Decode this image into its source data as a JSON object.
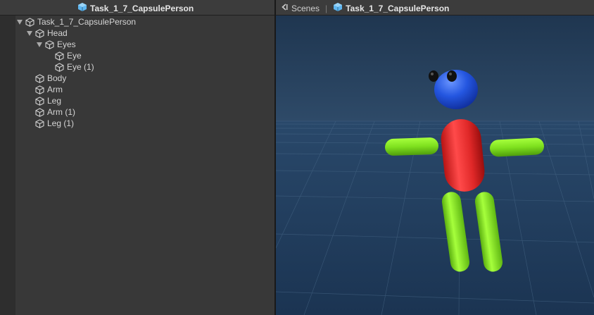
{
  "hierarchy": {
    "title": "Task_1_7_CapsulePerson",
    "items": [
      {
        "label": "Task_1_7_CapsulePerson",
        "expanded": true
      },
      {
        "label": "Head",
        "expanded": true
      },
      {
        "label": "Eyes",
        "expanded": true
      },
      {
        "label": "Eye"
      },
      {
        "label": "Eye (1)"
      },
      {
        "label": "Body"
      },
      {
        "label": "Arm"
      },
      {
        "label": "Leg"
      },
      {
        "label": "Arm (1)"
      },
      {
        "label": "Leg (1)"
      }
    ]
  },
  "scene": {
    "tab_label": "Scenes",
    "separator": "|",
    "scene_name": "Task_1_7_CapsulePerson"
  },
  "colors": {
    "head": "#2456e0",
    "body": "#e02828",
    "limbs": "#7ee01e",
    "eyes": "#111111",
    "sky": "#2a3d56",
    "ground": "#1e3a57",
    "accent_icon": "#5fb6f0"
  },
  "icons": {
    "scene_icon": "unity-scene-icon",
    "object_icon": "gameobject-cube-icon",
    "expand_icon": "tree-expand-triangle-icon"
  }
}
